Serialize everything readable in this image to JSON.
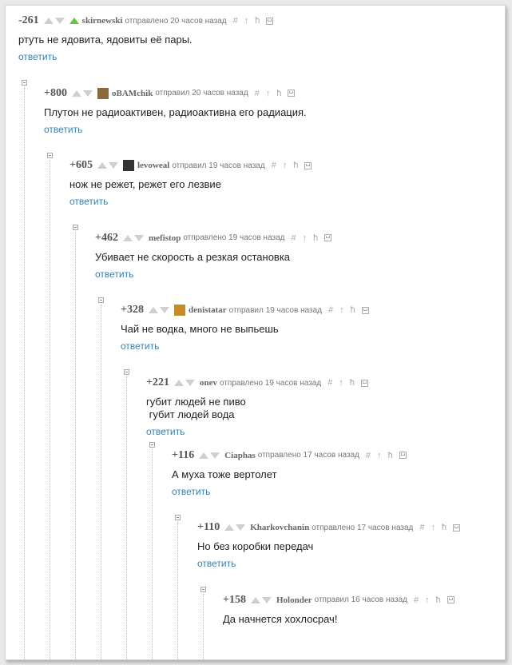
{
  "comments": [
    {
      "rating": "-261",
      "author": "skirnewski",
      "meta": "отправлено 20 часов назад",
      "text": "ртуть не ядовита, ядовиты её пары.",
      "reply": "ответить"
    },
    {
      "rating": "+800",
      "author": "oBAMchik",
      "meta": "отправил 20 часов назад",
      "text": "Плутон не радиоактивен, радиоактивна его радиация.",
      "reply": "ответить"
    },
    {
      "rating": "+605",
      "author": "levoweal",
      "meta": "отправил 19 часов назад",
      "text": "нож не режет, режет его лезвие",
      "reply": "ответить"
    },
    {
      "rating": "+462",
      "author": "mefistop",
      "meta": "отправлено 19 часов назад",
      "text": "Убивает не скорость а резкая остановка",
      "reply": "ответить"
    },
    {
      "rating": "+328",
      "author": "denistatar",
      "meta": "отправил 19 часов назад",
      "text": "Чай не водка, много не выпьешь",
      "reply": "ответить"
    },
    {
      "rating": "+221",
      "author": "onev",
      "meta": "отправлено 19 часов назад",
      "text": "губит людей не пиво\n губит людей вода",
      "reply": "ответить"
    },
    {
      "rating": "+116",
      "author": "Ciaphas",
      "meta": "отправлено 17 часов назад",
      "text": "А муха тоже вертолет",
      "reply": "ответить"
    },
    {
      "rating": "+110",
      "author": "Kharkovchanin",
      "meta": "отправлено 17 часов назад",
      "text": "Но без коробки передач",
      "reply": "ответить"
    },
    {
      "rating": "+158",
      "author": "Holonder",
      "meta": "отправил 16 часов назад",
      "text": "Да начнется хохлосрач!",
      "reply": ""
    }
  ],
  "tools": {
    "hash": "#",
    "up": "↑",
    "branch": "ħ"
  },
  "colors": {
    "reply_link": "#3d7fa8",
    "up_vote_active": "#6cc04a"
  }
}
